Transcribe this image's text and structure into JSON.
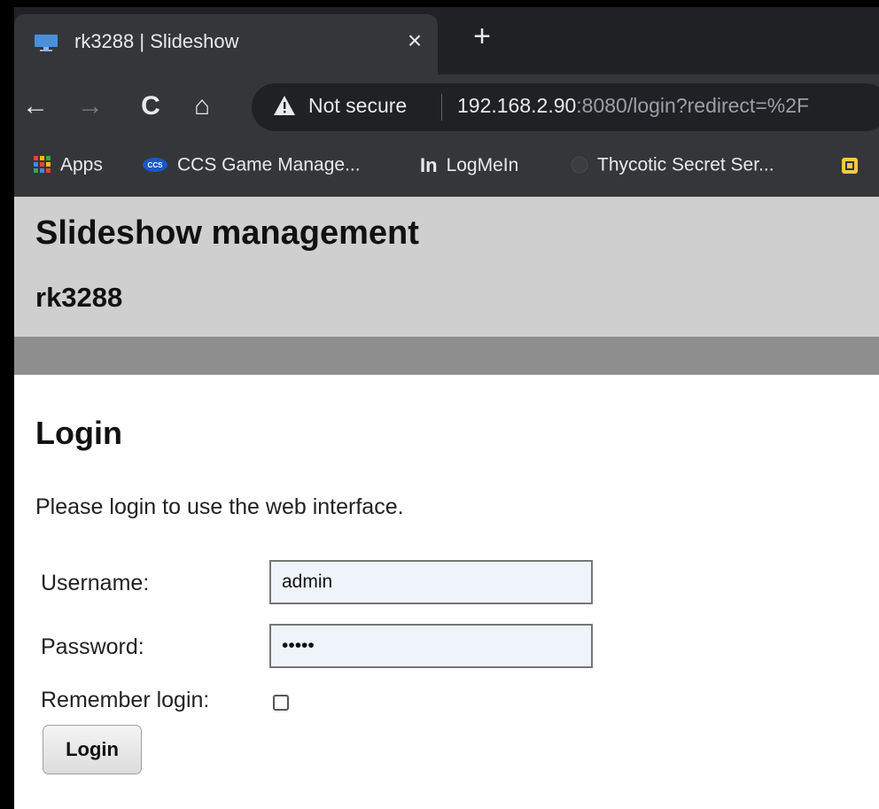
{
  "browser": {
    "tab": {
      "title": "rk3288 | Slideshow",
      "close_label": "×",
      "favicon_icon": "monitor-icon"
    },
    "new_tab_label": "+",
    "nav": {
      "back_label": "←",
      "forward_label": "→",
      "reload_label": "C",
      "home_label": "⌂"
    },
    "omnibox": {
      "security_label": "Not secure",
      "separator": "|",
      "url_host": "192.168.2.90",
      "url_rest": ":8080/login?redirect=%2F"
    },
    "bookmarks": [
      {
        "label": "Apps",
        "icon": "apps-grid-icon"
      },
      {
        "label": "CCS Game Manage...",
        "icon": "ccs-icon"
      },
      {
        "label": "LogMeIn",
        "icon": "logmein-icon"
      },
      {
        "label": "Thycotic Secret Ser...",
        "icon": "thycotic-icon"
      }
    ]
  },
  "page": {
    "title": "Slideshow management",
    "subtitle": "rk3288",
    "login": {
      "heading": "Login",
      "intro": "Please login to use the web interface.",
      "username_label": "Username:",
      "username_value": "admin",
      "password_label": "Password:",
      "password_value": "•••••",
      "remember_label": "Remember login:",
      "remember_checked": false,
      "button_label": "Login"
    }
  },
  "colors": {
    "chrome_dark": "#202124",
    "chrome_toolbar": "#35363a",
    "header_bg": "#cfcfcf",
    "navbar_bg": "#8e8e8e",
    "input_bg": "#eef4f9"
  }
}
